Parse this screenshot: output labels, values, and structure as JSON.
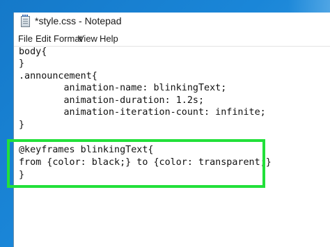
{
  "window": {
    "title": "*style.css - Notepad",
    "app_icon": "notepad-icon"
  },
  "menu": [
    {
      "label": "File"
    },
    {
      "label": "Edit"
    },
    {
      "label": "Format"
    },
    {
      "label": "View"
    },
    {
      "label": "Help"
    }
  ],
  "editor": {
    "lines": [
      "body{",
      "}",
      ".announcement{",
      "        animation-name: blinkingText;",
      "        animation-duration: 1.2s;",
      "        animation-iteration-count: infinite;",
      "}",
      "",
      "@keyframes blinkingText{",
      "from {color: black;} to {color: transparent;}",
      "}"
    ],
    "highlight_color": "#22e03a"
  },
  "colors": {
    "desktop": "#1a86d8",
    "window_bg": "#ffffff",
    "text": "#111111"
  }
}
